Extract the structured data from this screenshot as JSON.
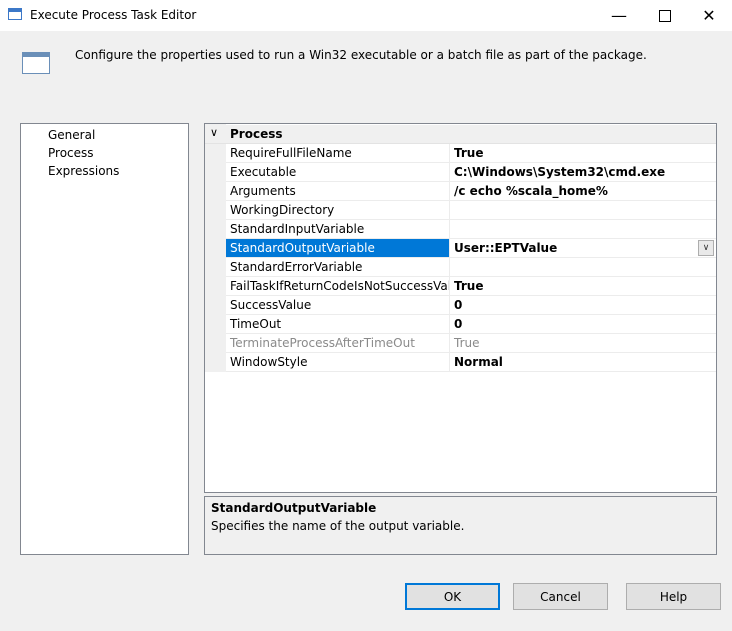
{
  "window": {
    "title": "Execute Process Task Editor",
    "minimize_glyph": "—",
    "close_glyph": "✕"
  },
  "header": {
    "description": "Configure the properties used to run a Win32 executable or a batch file as part of the package."
  },
  "nav": {
    "items": [
      {
        "label": "General"
      },
      {
        "label": "Process"
      },
      {
        "label": "Expressions"
      }
    ],
    "selected": "Process"
  },
  "grid": {
    "category": {
      "label": "Process",
      "chevron": "∨"
    },
    "rows": [
      {
        "name": "RequireFullFileName",
        "value": "True"
      },
      {
        "name": "Executable",
        "value": "C:\\Windows\\System32\\cmd.exe"
      },
      {
        "name": "Arguments",
        "value": "/c echo %scala_home%"
      },
      {
        "name": "WorkingDirectory",
        "value": ""
      },
      {
        "name": "StandardInputVariable",
        "value": ""
      },
      {
        "name": "StandardOutputVariable",
        "value": "User::EPTValue"
      },
      {
        "name": "StandardErrorVariable",
        "value": ""
      },
      {
        "name": "FailTaskIfReturnCodeIsNotSuccessValue",
        "value": "True"
      },
      {
        "name": "SuccessValue",
        "value": "0"
      },
      {
        "name": "TimeOut",
        "value": "0"
      },
      {
        "name": "TerminateProcessAfterTimeOut",
        "value": "True"
      },
      {
        "name": "WindowStyle",
        "value": "Normal"
      }
    ],
    "selected_row": "StandardOutputVariable",
    "disabled_row": "TerminateProcessAfterTimeOut",
    "dropdown_glyph": "∨",
    "selection_color": "#0078d7"
  },
  "description_panel": {
    "title": "StandardOutputVariable",
    "text": "Specifies the name of the output variable."
  },
  "buttons": {
    "ok": "OK",
    "cancel": "Cancel",
    "help": "Help"
  }
}
